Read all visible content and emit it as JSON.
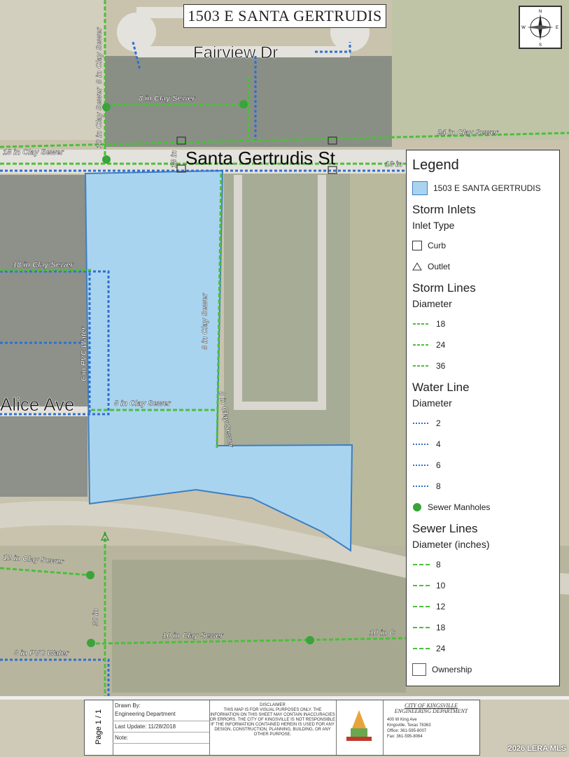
{
  "map": {
    "title": "1503 E SANTA GERTRUDIS",
    "streets": {
      "fairview": "Fairview Dr",
      "santa_gertrudis": "Santa Gertrudis St",
      "alice": "Alice Ave"
    },
    "line_labels": {
      "sewer_8_top_vertical": "8 in Clay Sewer",
      "sewer_8_top": "8 in Clay Sewer",
      "sewer_10_vertical": "10 in Clay Sewer",
      "sewer_24": "24 in Clay Sewer",
      "sewer_18_left": "18 in Clay Sewer",
      "sewer_18_short": "18 in",
      "sewer_18_right": "18 in",
      "sewer_18_mid": "18 in Clay Sewer",
      "water_6_pvc": "6 in PVC Water",
      "sewer_8_mid": "8 in Clay Sewer",
      "sewer_8_vertical_mid": "8 in Clay Sewer",
      "sewer_8_vertical_low": "8 in Clay Sewer",
      "sewer_12": "12 in Clay Sewer",
      "sewer_30": "30 in",
      "sewer_10_bottom": "10 in Clay Sewer",
      "sewer_10_bottom_right": "10 in C",
      "water_8_pvc": "8 in PVC Water"
    },
    "colors": {
      "parcel_fill": "#a9d4f0",
      "parcel_stroke": "#3d7fc1",
      "sewer_green": "#4bbf3a",
      "water_blue": "#2f6fd0",
      "manhole": "#3aa43a"
    }
  },
  "compass": {
    "n": "N",
    "s": "S",
    "e": "E",
    "w": "W"
  },
  "legend": {
    "title": "Legend",
    "parcel": "1503 E SANTA GERTRUDIS",
    "storm_inlets": "Storm Inlets",
    "inlet_type": "Inlet Type",
    "curb": "Curb",
    "outlet": "Outlet",
    "storm_lines": "Storm Lines",
    "storm_diameter": "Diameter",
    "storm_sizes": [
      "18",
      "24",
      "36"
    ],
    "water_line": "Water Line",
    "water_diameter": "Diameter",
    "water_sizes": [
      "2",
      "4",
      "6",
      "8"
    ],
    "manholes": "Sewer Manholes",
    "sewer_lines": "Sewer Lines",
    "sewer_diameter": "Diameter (inches)",
    "sewer_sizes": [
      "8",
      "10",
      "12",
      "18",
      "24"
    ],
    "ownership": "Ownership"
  },
  "footer": {
    "page": "Page 1 / 1",
    "drawn_by_label": "Drawn By:",
    "drawn_by": "Engineering Department",
    "last_update": "Last Update: 11/28/2018",
    "note": "Note:",
    "disclaimer_title": "DISCLAIMER",
    "disclaimer": "THIS MAP IS FOR VISUAL PURPOSES ONLY. THE INFORMATION ON THIS SHEET MAY CONTAIN INACCURACIES OR ERRORS. THE CITY OF KINGSVILLE IS NOT RESPONSIBLE IF THE INFORMATION CONTAINED HEREIN IS USED FOR ANY DESIGN, CONSTRUCTION, PLANNING, BUILDING, OR ANY OTHER PURPOSE.",
    "city": "CITY OF KINGSVILLE",
    "dept": "ENGINEERING DEPARTMENT",
    "addr1": "400 W King Ave",
    "addr2": "Kingsville, Texas 78363",
    "office": "Office: 361-595-8007",
    "fax": "Fax: 361-595-8064"
  },
  "watermark": "2026 LERA MLS"
}
